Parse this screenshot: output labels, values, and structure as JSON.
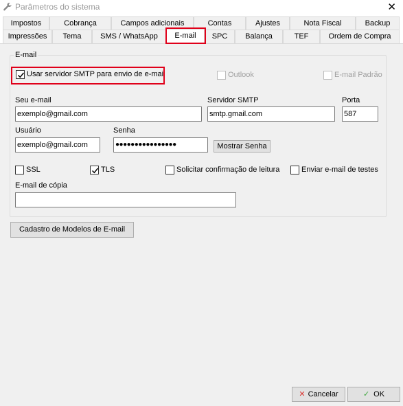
{
  "window": {
    "title": "Parâmetros do sistema"
  },
  "tabs": {
    "row1": [
      "Impostos",
      "Cobrança",
      "Campos adicionais",
      "Contas",
      "Ajustes",
      "Nota Fiscal",
      "Backup"
    ],
    "row2": [
      "Impressões",
      "Tema",
      "SMS / WhatsApp",
      "E-mail",
      "SPC",
      "Balança",
      "TEF",
      "Ordem de Compra"
    ],
    "active": "E-mail"
  },
  "email": {
    "group_title": "E-mail",
    "use_smtp_label": "Usar servidor SMTP para envio de e-mail",
    "use_smtp_checked": true,
    "outlook_label": "Outlook",
    "default_label": "E-mail Padrão",
    "seu_email_label": "Seu e-mail",
    "seu_email_value": "exemplo@gmail.com",
    "smtp_label": "Servidor SMTP",
    "smtp_value": "smtp.gmail.com",
    "porta_label": "Porta",
    "porta_value": "587",
    "usuario_label": "Usuário",
    "usuario_value": "exemplo@gmail.com",
    "senha_label": "Senha",
    "senha_value": "●●●●●●●●●●●●●●●●",
    "mostrar_senha": "Mostrar Senha",
    "ssl_label": "SSL",
    "tls_label": "TLS",
    "tls_checked": true,
    "confirm_label": "Solicitar confirmação de leitura",
    "test_label": "Enviar e-mail de testes",
    "copia_label": "E-mail de cópia",
    "copia_value": ""
  },
  "buttons": {
    "cadastro": "Cadastro de Modelos de E-mail",
    "cancelar": "Cancelar",
    "ok": "OK"
  },
  "colors": {
    "highlight": "#e0001a",
    "ok_check": "#3aa63a",
    "cancel_x": "#d9322e"
  }
}
